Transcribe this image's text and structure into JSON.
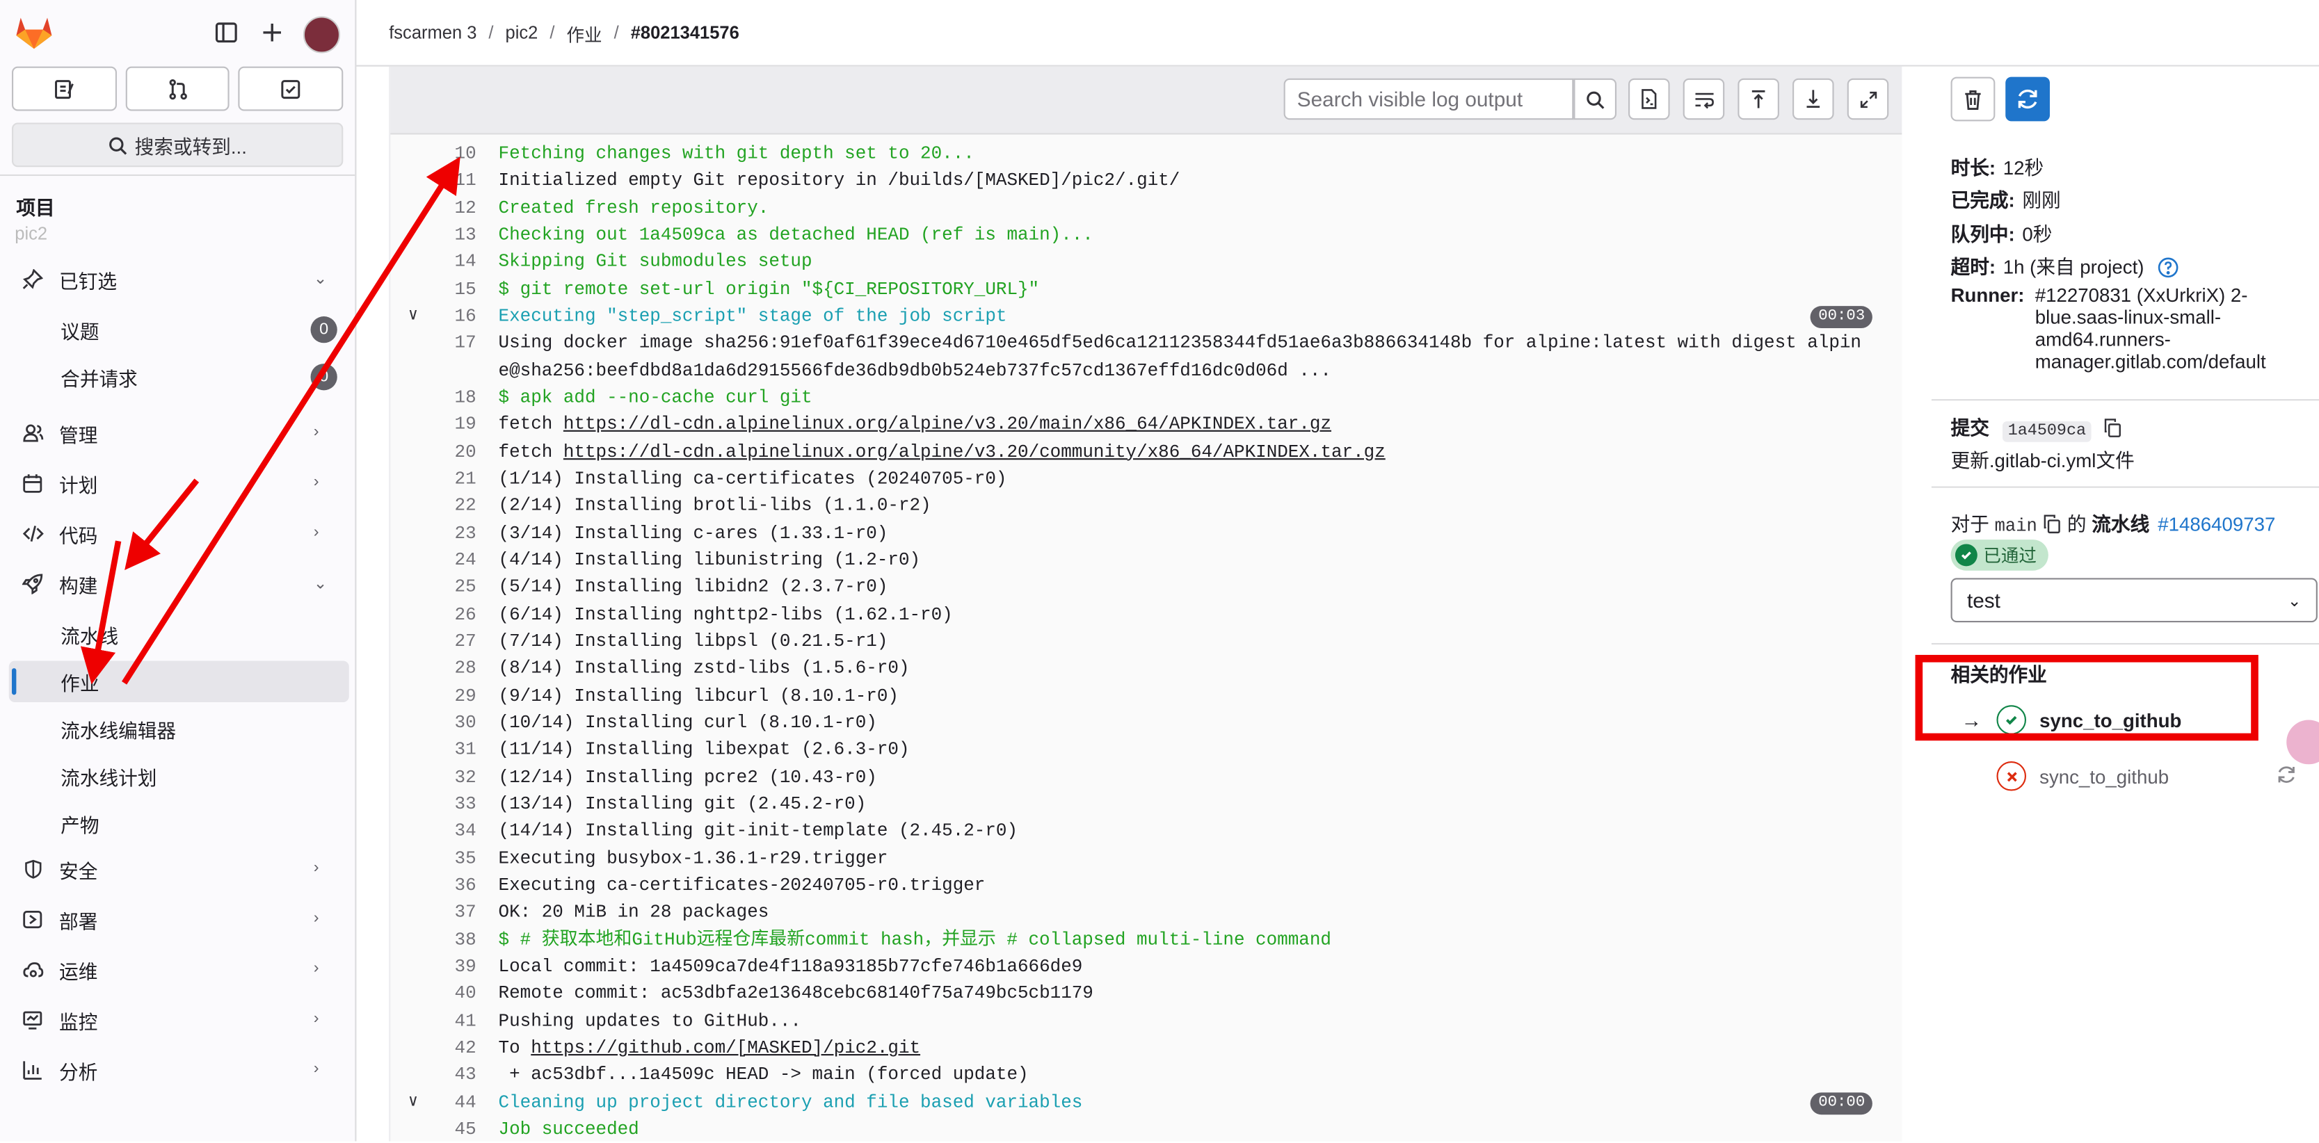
{
  "sidebar": {
    "search_label": "搜索或转到...",
    "section_label": "项目",
    "ghost_item": "pic2",
    "pinned": {
      "label": "已钉选",
      "items": [
        {
          "label": "议题",
          "count": "0"
        },
        {
          "label": "合并请求",
          "count": "0"
        }
      ]
    },
    "nav": [
      {
        "label": "管理"
      },
      {
        "label": "计划"
      },
      {
        "label": "代码"
      },
      {
        "label": "构建"
      }
    ],
    "build_sub": [
      {
        "label": "流水线"
      },
      {
        "label": "作业"
      },
      {
        "label": "流水线编辑器"
      },
      {
        "label": "流水线计划"
      },
      {
        "label": "产物"
      }
    ],
    "nav2": [
      {
        "label": "安全"
      },
      {
        "label": "部署"
      },
      {
        "label": "运维"
      },
      {
        "label": "监控"
      },
      {
        "label": "分析"
      }
    ]
  },
  "breadcrumb": {
    "items": [
      "fscarmen 3",
      "pic2",
      "作业"
    ],
    "current": "#8021341576",
    "separator": "/"
  },
  "log": {
    "search_placeholder": "Search visible log output",
    "lines": [
      {
        "n": "10",
        "t": "Fetching changes with git depth set to 20...",
        "c": "g"
      },
      {
        "n": "11",
        "t": "Initialized empty Git repository in /builds/[MASKED]/pic2/.git/",
        "c": ""
      },
      {
        "n": "12",
        "t": "Created fresh repository.",
        "c": "g"
      },
      {
        "n": "13",
        "t": "Checking out 1a4509ca as detached HEAD (ref is main)...",
        "c": "g"
      },
      {
        "n": "14",
        "t": "Skipping Git submodules setup",
        "c": "g"
      },
      {
        "n": "15",
        "t": "$ git remote set-url origin \"${CI_REPOSITORY_URL}\"",
        "c": "g"
      },
      {
        "n": "16",
        "t": "Executing \"step_script\" stage of the job script",
        "c": "c",
        "dur": "00:03"
      },
      {
        "n": "17",
        "t": "Using docker image sha256:91ef0af61f39ece4d6710e465df5ed6ca12112358344fd51ae6a3b886634148b for alpine:latest with digest alpine@sha256:beefdbd8a1da6d2915566fde36db9db0b524eb737fc57cd1367effd16dc0d06d ...",
        "c": "",
        "wrap": true
      },
      {
        "n": "18",
        "t": "$ apk add --no-cache curl git",
        "c": "g"
      },
      {
        "n": "19",
        "pre": "fetch ",
        "link": "https://dl-cdn.alpinelinux.org/alpine/v3.20/main/x86_64/APKINDEX.tar.gz",
        "c": ""
      },
      {
        "n": "20",
        "pre": "fetch ",
        "link": "https://dl-cdn.alpinelinux.org/alpine/v3.20/community/x86_64/APKINDEX.tar.gz",
        "c": ""
      },
      {
        "n": "21",
        "t": "(1/14) Installing ca-certificates (20240705-r0)",
        "c": ""
      },
      {
        "n": "22",
        "t": "(2/14) Installing brotli-libs (1.1.0-r2)",
        "c": ""
      },
      {
        "n": "23",
        "t": "(3/14) Installing c-ares (1.33.1-r0)",
        "c": ""
      },
      {
        "n": "24",
        "t": "(4/14) Installing libunistring (1.2-r0)",
        "c": ""
      },
      {
        "n": "25",
        "t": "(5/14) Installing libidn2 (2.3.7-r0)",
        "c": ""
      },
      {
        "n": "26",
        "t": "(6/14) Installing nghttp2-libs (1.62.1-r0)",
        "c": ""
      },
      {
        "n": "27",
        "t": "(7/14) Installing libpsl (0.21.5-r1)",
        "c": ""
      },
      {
        "n": "28",
        "t": "(8/14) Installing zstd-libs (1.5.6-r0)",
        "c": ""
      },
      {
        "n": "29",
        "t": "(9/14) Installing libcurl (8.10.1-r0)",
        "c": ""
      },
      {
        "n": "30",
        "t": "(10/14) Installing curl (8.10.1-r0)",
        "c": ""
      },
      {
        "n": "31",
        "t": "(11/14) Installing libexpat (2.6.3-r0)",
        "c": ""
      },
      {
        "n": "32",
        "t": "(12/14) Installing pcre2 (10.43-r0)",
        "c": ""
      },
      {
        "n": "33",
        "t": "(13/14) Installing git (2.45.2-r0)",
        "c": ""
      },
      {
        "n": "34",
        "t": "(14/14) Installing git-init-template (2.45.2-r0)",
        "c": ""
      },
      {
        "n": "35",
        "t": "Executing busybox-1.36.1-r29.trigger",
        "c": ""
      },
      {
        "n": "36",
        "t": "Executing ca-certificates-20240705-r0.trigger",
        "c": ""
      },
      {
        "n": "37",
        "t": "OK: 20 MiB in 28 packages",
        "c": ""
      },
      {
        "n": "38",
        "t": "$ # 获取本地和GitHub远程仓库最新commit hash，并显示 # collapsed multi-line command",
        "c": "g"
      },
      {
        "n": "39",
        "t": "Local commit: 1a4509ca7de4f118a93185b77cfe746b1a666de9",
        "c": ""
      },
      {
        "n": "40",
        "t": "Remote commit: ac53dbfa2e13648cebc68140f75a749bc5cb1179",
        "c": ""
      },
      {
        "n": "41",
        "t": "Pushing updates to GitHub...",
        "c": ""
      },
      {
        "n": "42",
        "pre": "To ",
        "link": "https://github.com/[MASKED]/pic2.git",
        "c": ""
      },
      {
        "n": "43",
        "t": " + ac53dbf...1a4509c HEAD -> main (forced update)",
        "c": ""
      },
      {
        "n": "44",
        "t": "Cleaning up project directory and file based variables",
        "c": "c",
        "dur": "00:00"
      },
      {
        "n": "45",
        "t": "Job succeeded",
        "c": "g"
      }
    ]
  },
  "job": {
    "duration_label": "时长:",
    "duration": "12秒",
    "finished_label": "已完成:",
    "finished": "刚刚",
    "queued_label": "队列中:",
    "queued": "0秒",
    "timeout_label": "超时:",
    "timeout": "1h (来自 project)",
    "runner_label": "Runner:",
    "runner": "#12270831 (XxUrkriX) 2-blue.saas-linux-small-amd64.runners-manager.gitlab.com/default",
    "commit_label": "提交",
    "commit_sha": "1a4509ca",
    "commit_title": "更新.gitlab-ci.yml文件",
    "pipeline_for": "对于",
    "pipeline_ref": "main",
    "pipeline_of": "的",
    "pipeline_label": "流水线",
    "pipeline_id": "#1486409737",
    "pipeline_status": "已通过",
    "stage": "test",
    "related_title": "相关的作业",
    "related": [
      {
        "name": "sync_to_github",
        "status": "success",
        "current": true,
        "arrow": "→"
      },
      {
        "name": "sync_to_github",
        "status": "failed",
        "current": false
      }
    ]
  },
  "colors": {
    "accent": "#1f75cb",
    "success": "#108548",
    "failed": "#dd2b0e",
    "annotation": "#ee0000"
  }
}
